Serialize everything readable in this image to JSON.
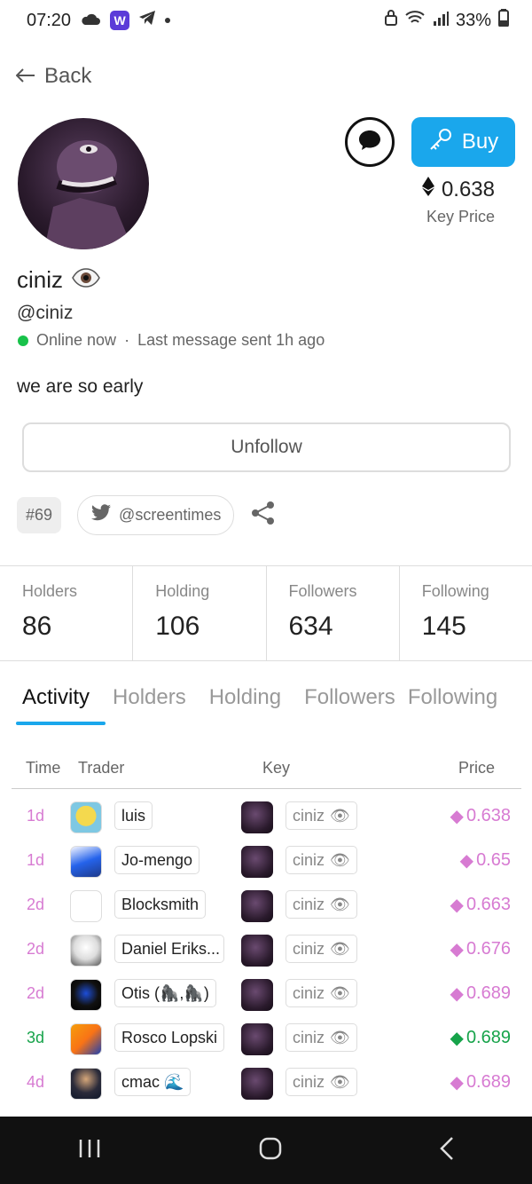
{
  "status": {
    "time": "07:20",
    "battery": "33%",
    "app_badge": "W"
  },
  "nav": {
    "back_label": "Back"
  },
  "profile": {
    "name": "ciniz",
    "handle": "@ciniz",
    "online_text": "Online now",
    "last_message": "Last message sent 1h ago",
    "bio": "we are so early",
    "key_price": "0.638",
    "key_price_label": "Key Price",
    "buy_label": "Buy",
    "unfollow_label": "Unfollow",
    "rank": "#69",
    "twitter": "@screentimes"
  },
  "stats": [
    {
      "label": "Holders",
      "value": "86"
    },
    {
      "label": "Holding",
      "value": "106"
    },
    {
      "label": "Followers",
      "value": "634"
    },
    {
      "label": "Following",
      "value": "145"
    }
  ],
  "tabs": [
    "Activity",
    "Holders",
    "Holding",
    "Followers",
    "Following"
  ],
  "table": {
    "headers": {
      "time": "Time",
      "trader": "Trader",
      "key": "Key",
      "price": "Price"
    },
    "rows": [
      {
        "time": "1d",
        "trader": "luis",
        "key": "ciniz",
        "price": "0.638",
        "side": "sell"
      },
      {
        "time": "1d",
        "trader": "Jo-mengo",
        "key": "ciniz",
        "price": "0.65",
        "side": "sell"
      },
      {
        "time": "2d",
        "trader": "Blocksmith",
        "key": "ciniz",
        "price": "0.663",
        "side": "sell"
      },
      {
        "time": "2d",
        "trader": "Daniel Eriks...",
        "key": "ciniz",
        "price": "0.676",
        "side": "sell"
      },
      {
        "time": "2d",
        "trader": "Otis (🦍,🦍)",
        "key": "ciniz",
        "price": "0.689",
        "side": "sell"
      },
      {
        "time": "3d",
        "trader": "Rosco Lopski",
        "key": "ciniz",
        "price": "0.689",
        "side": "buy"
      },
      {
        "time": "4d",
        "trader": "cmac 🌊",
        "key": "ciniz",
        "price": "0.689",
        "side": "sell"
      }
    ]
  },
  "colors": {
    "accent": "#1aa7ec",
    "sell": "#d77bd2",
    "buy": "#16a34a",
    "online": "#18c24a"
  }
}
